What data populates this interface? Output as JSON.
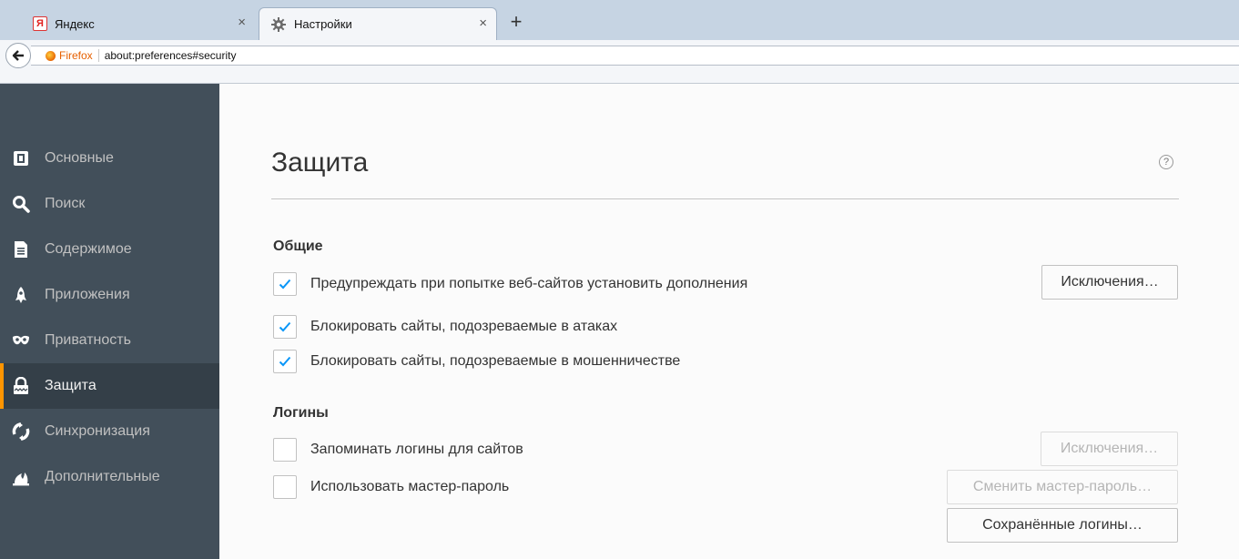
{
  "browser": {
    "tabs": [
      {
        "title": "Яндекс",
        "icon": "yandex-icon",
        "icon_glyph": "Я",
        "active": false
      },
      {
        "title": "Настройки",
        "icon": "gear-icon",
        "active": true
      }
    ],
    "close_glyph": "×",
    "new_tab_glyph": "+",
    "identity_label": "Firefox",
    "url": "about:preferences#security"
  },
  "sidebar": {
    "items": [
      {
        "label": "Основные",
        "icon": "general-icon",
        "selected": false
      },
      {
        "label": "Поиск",
        "icon": "search-icon",
        "selected": false
      },
      {
        "label": "Содержимое",
        "icon": "content-icon",
        "selected": false
      },
      {
        "label": "Приложения",
        "icon": "applications-icon",
        "selected": false
      },
      {
        "label": "Приватность",
        "icon": "privacy-mask-icon",
        "selected": false
      },
      {
        "label": "Защита",
        "icon": "security-lock-icon",
        "selected": true
      },
      {
        "label": "Синхронизация",
        "icon": "sync-icon",
        "selected": false
      },
      {
        "label": "Дополнительные",
        "icon": "advanced-icon",
        "selected": false
      }
    ],
    "colors": {
      "background": "#424f5a",
      "selected_bg": "#343f48",
      "accent": "#ff9500"
    }
  },
  "main": {
    "title": "Защита",
    "help_glyph": "?",
    "general": {
      "heading": "Общие",
      "options": [
        {
          "label": "Предупреждать при попытке веб-сайтов установить дополнения",
          "checked": true
        },
        {
          "label": "Блокировать сайты, подозреваемые в атаках",
          "checked": true
        },
        {
          "label": "Блокировать сайты, подозреваемые в мошенничестве",
          "checked": true
        }
      ],
      "exceptions_button": "Исключения…"
    },
    "logins": {
      "heading": "Логины",
      "options": [
        {
          "label": "Запоминать логины для сайтов",
          "checked": false
        },
        {
          "label": "Использовать мастер-пароль",
          "checked": false
        }
      ],
      "exceptions_button": "Исключения…",
      "change_master_button": "Сменить мастер-пароль…",
      "saved_logins_button": "Сохранённые логины…"
    },
    "check_color": "#0996f8"
  }
}
